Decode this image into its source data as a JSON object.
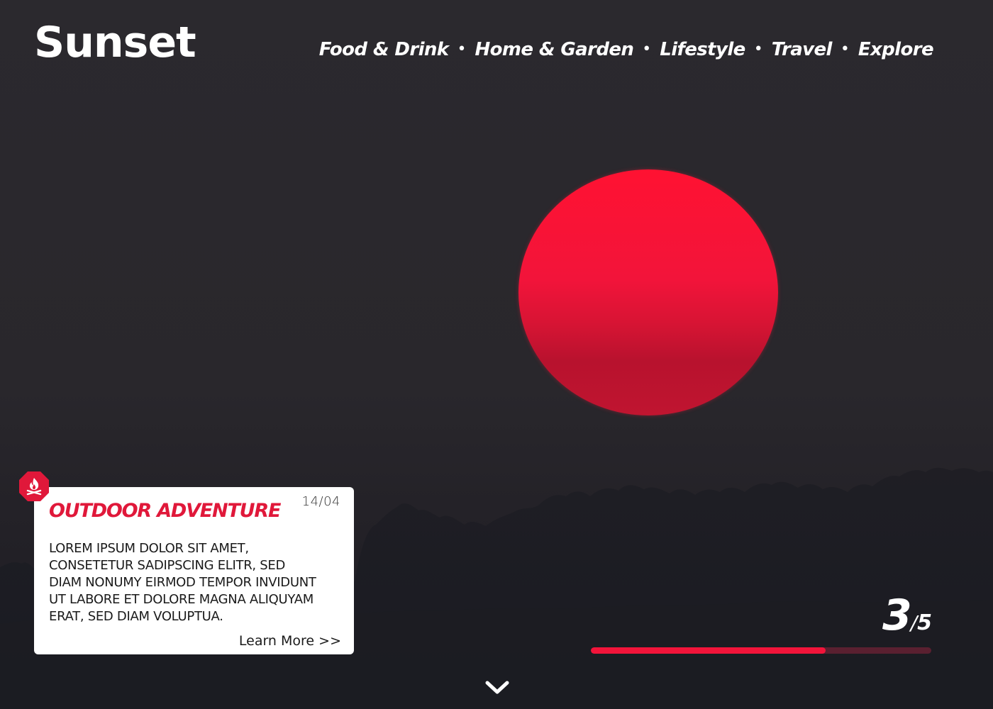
{
  "site": {
    "logo": "Sunset"
  },
  "nav": {
    "items": [
      "Food & Drink",
      "Home & Garden",
      "Lifestyle",
      "Travel",
      "Explore"
    ],
    "separator": "•"
  },
  "card": {
    "badge_icon": "campfire-icon",
    "title": "Outdoor Adventure",
    "date": "14/04",
    "text": "Lorem ipsum dolor sit amet, consetetur sadipscing elitr, sed diam nonumy eirmod tempor invidunt ut labore et dolore magna aliquyam erat, sed diam voluptua.",
    "link": "Learn More >>"
  },
  "slider": {
    "current": "3",
    "separator": "/",
    "total": "5",
    "progress": 0.69
  },
  "scroll": {
    "icon": "chevron-down-icon"
  },
  "colors": {
    "accent": "#f2143a",
    "background": "#2a282d",
    "card": "#ffffff",
    "text_light": "#ffffff"
  }
}
